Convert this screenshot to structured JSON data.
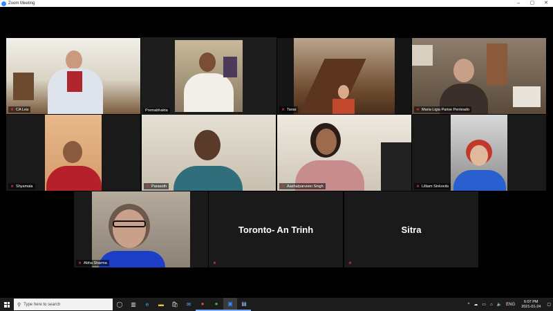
{
  "window": {
    "title": "Zoom Meeting",
    "controls": [
      "–",
      "▢",
      "✕"
    ]
  },
  "participants": [
    {
      "name": "CA Lea",
      "muted": true,
      "active": false,
      "video": true
    },
    {
      "name": "Premabhakta",
      "muted": false,
      "active": true,
      "video": true
    },
    {
      "name": "Taras",
      "muted": true,
      "active": false,
      "video": true
    },
    {
      "name": "Maria Ligia Parise Penteado",
      "muted": true,
      "active": false,
      "video": true
    },
    {
      "name": "Shyamala",
      "muted": true,
      "active": false,
      "video": true
    },
    {
      "name": "Parasoth",
      "muted": true,
      "active": false,
      "video": true
    },
    {
      "name": "Aasha/parveen Singh",
      "muted": true,
      "active": false,
      "video": true
    },
    {
      "name": "Lilliam Sinkovits",
      "muted": true,
      "active": false,
      "video": true
    },
    {
      "name": "Abha Sharma",
      "muted": true,
      "active": false,
      "video": true
    },
    {
      "name": "Toronto- An Trinh",
      "muted": true,
      "active": false,
      "video": false
    },
    {
      "name": "Sitra",
      "muted": true,
      "active": false,
      "video": false
    }
  ],
  "taskbar": {
    "search_placeholder": "Type here to search",
    "icons": [
      "task-view-icon",
      "edge-icon",
      "file-explorer-icon",
      "store-icon",
      "mail-icon",
      "chrome-alt-icon",
      "chrome-icon",
      "zoom-icon",
      "zoom-meeting-icon"
    ],
    "tray": {
      "lang": "ENG",
      "time": "6:07 PM",
      "date": "2021-01-24"
    }
  },
  "colors": {
    "active_border": "#b6e06a",
    "muted_mic": "#e23b3b",
    "zoom_blue": "#2d8cff"
  }
}
